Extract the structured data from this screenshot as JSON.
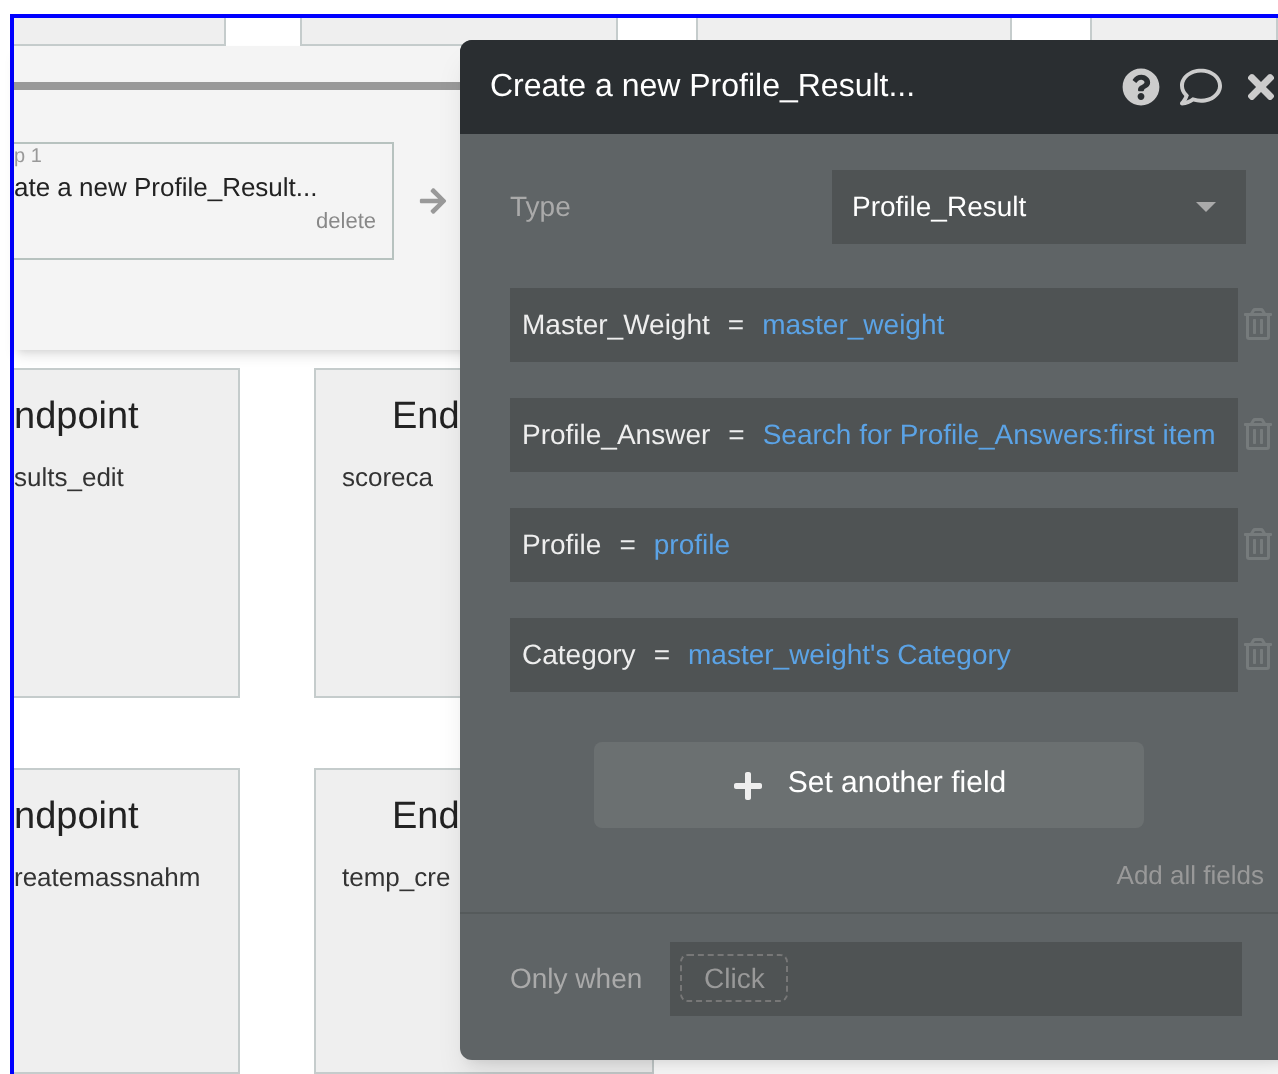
{
  "canvas": {
    "step": {
      "label": "p 1",
      "title": "ate a new Profile_Result...",
      "delete": "delete"
    },
    "cards": [
      {
        "title": "ndpoint",
        "subtitle": "sults_edit"
      },
      {
        "title": "End",
        "subtitle": "scoreca"
      },
      {
        "title": "ndpoint",
        "subtitle": "reatemassnahm"
      },
      {
        "title": "End",
        "subtitle": "temp_cre"
      }
    ]
  },
  "panel": {
    "title": "Create a new Profile_Result...",
    "type_label": "Type",
    "type_value": "Profile_Result",
    "fields": [
      {
        "name": "Master_Weight",
        "operator": "=",
        "value": "master_weight"
      },
      {
        "name": "Profile_Answer",
        "operator": "=",
        "value": "Search for Profile_Answers:first item"
      },
      {
        "name": "Profile",
        "operator": "=",
        "value": "profile"
      },
      {
        "name": "Category",
        "operator": "=",
        "value": "master_weight's Category"
      }
    ],
    "add_button": "Set another field",
    "add_all": "Add all fields",
    "only_when_label": "Only when",
    "only_when_placeholder": "Click"
  }
}
